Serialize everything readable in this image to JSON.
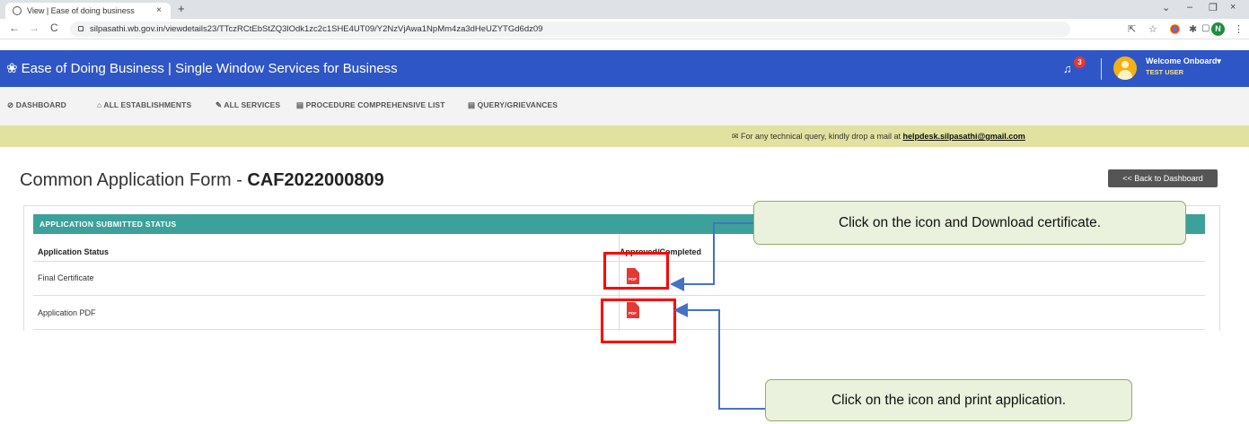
{
  "browser": {
    "tab_title": "View | Ease of doing business",
    "tab_close": "×",
    "new_tab": "+",
    "url": "silpasathi.wb.gov.in/viewdetails23/TTczRCtEbStZQ3lOdk1zc2c1SHE4UT09/Y2NzVjAwa1NpMm4za3dHeUZYTGd6dz09",
    "nav": {
      "back": "←",
      "forward": "→",
      "reload": "C"
    },
    "window": {
      "minimize": "–",
      "restore": "❐",
      "close": "×",
      "dropdown": "⌄"
    },
    "profile_initial": "N",
    "menu_dots": "⋮"
  },
  "header": {
    "logo_glyph": "❀",
    "app_title": "Ease of Doing Business | Single Window Services for Business",
    "notification_count": "3",
    "welcome_text": "Welcome Onboard▾",
    "user_name": "TEST USER"
  },
  "menu": {
    "items": [
      {
        "icon": "⊘",
        "label": "DASHBOARD"
      },
      {
        "icon": "⌂",
        "label": "ALL ESTABLISHMENTS"
      },
      {
        "icon": "✎",
        "label": "ALL SERVICES"
      },
      {
        "icon": "▤",
        "label": "PROCEDURE COMPREHENSIVE LIST"
      },
      {
        "icon": "▤",
        "label": "QUERY/GRIEVANCES"
      }
    ]
  },
  "notice": {
    "text": "✉ For any technical query, kindly drop a mail at ",
    "email": "helpdesk.silpasathi@gmail.com"
  },
  "page": {
    "title_prefix": "Common Application Form - ",
    "caf_number": "CAF2022000809",
    "back_button": "<< Back to Dashboard"
  },
  "status_panel": {
    "heading": "APPLICATION SUBMITTED STATUS",
    "columns": [
      "Application Status",
      "Approved/Completed"
    ],
    "rows": [
      {
        "label": "Final Certificate",
        "icon": "pdf-icon"
      },
      {
        "label": "Application PDF",
        "icon": "pdf-icon"
      }
    ],
    "pdf_icon_text": "PDF"
  },
  "annotations": {
    "download_certificate": "Click on the icon and Download certificate.",
    "print_application": "Click on the icon and print application."
  },
  "colors": {
    "header_blue": "#2f56c6",
    "teal_heading": "#3ca19a",
    "notice_yellow": "#e2e2a0",
    "highlight_red": "#ff0000",
    "callout_green": "#eaf1dd",
    "arrow_blue": "#4472c4"
  }
}
